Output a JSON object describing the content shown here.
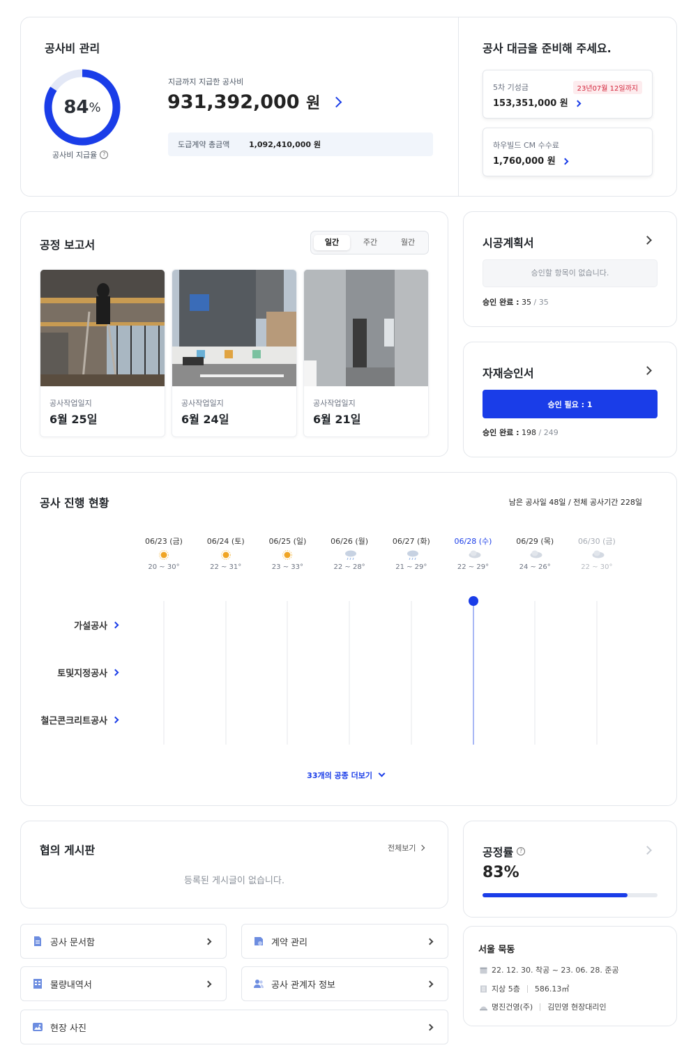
{
  "cost": {
    "title": "공사비 관리",
    "percent": "84",
    "percent_unit": "%",
    "percent_value": 0.84,
    "ring_label": "공사비 지급율",
    "paid_label": "지금까지 지급한 공사비",
    "paid_amount": "931,392,000",
    "won": "원",
    "contract_label": "도급계약 총금액",
    "contract_amount": "1,092,410,000 원"
  },
  "payment": {
    "title": "공사 대금을 준비해 주세요.",
    "items": [
      {
        "label": "5차 기성금",
        "amount": "153,351,000 원",
        "badge": "23년07월 12일까지"
      },
      {
        "label": "하우빌드 CM 수수료",
        "amount": "1,760,000 원",
        "badge": ""
      }
    ]
  },
  "report": {
    "title": "공정 보고서",
    "tabs": [
      "일간",
      "주간",
      "월간"
    ],
    "active_tab": "일간",
    "cards": [
      {
        "label": "공사작업일지",
        "date": "6월 25일"
      },
      {
        "label": "공사작업일지",
        "date": "6월 24일"
      },
      {
        "label": "공사작업일지",
        "date": "6월 21일"
      }
    ]
  },
  "plan": {
    "title": "시공계획서",
    "empty": "승인할 항목이 없습니다.",
    "done_label": "승인 완료 :",
    "done_count": "35",
    "done_total": "/ 35"
  },
  "material": {
    "title": "자재승인서",
    "button": "승인 필요 : 1",
    "done_label": "승인 완료 :",
    "done_count": "198",
    "done_total": "/ 249"
  },
  "progress": {
    "title": "공사 진행 현황",
    "summary": "남은 공사일 48일 / 전체 공사기간 228일",
    "days": [
      {
        "date": "06/23 (금)",
        "temp": "20 ~ 30°",
        "icon": "sun"
      },
      {
        "date": "06/24 (토)",
        "temp": "22 ~ 31°",
        "icon": "sun"
      },
      {
        "date": "06/25 (일)",
        "temp": "23 ~ 33°",
        "icon": "sun"
      },
      {
        "date": "06/26 (월)",
        "temp": "22 ~ 28°",
        "icon": "rain"
      },
      {
        "date": "06/27 (화)",
        "temp": "21 ~ 29°",
        "icon": "rain"
      },
      {
        "date": "06/28 (수)",
        "temp": "22 ~ 29°",
        "icon": "cloud"
      },
      {
        "date": "06/29 (목)",
        "temp": "24 ~ 26°",
        "icon": "cloud"
      },
      {
        "date": "06/30 (금)",
        "temp": "22 ~ 30°",
        "icon": "cloud"
      }
    ],
    "today_index": 5,
    "trades": [
      "가설공사",
      "토및지정공사",
      "철근콘크리트공사"
    ],
    "more": "33개의 공종 더보기"
  },
  "board": {
    "title": "협의 게시판",
    "view_all": "전체보기",
    "empty": "등록된 게시글이 없습니다."
  },
  "rate": {
    "title": "공정률",
    "value": "83%",
    "fraction": 0.83
  },
  "nav": [
    {
      "label": "공사 문서함",
      "icon": "document-icon"
    },
    {
      "label": "계약 관리",
      "icon": "contract-icon"
    },
    {
      "label": "물량내역서",
      "icon": "quantity-icon"
    },
    {
      "label": "공사 관계자 정보",
      "icon": "people-icon"
    },
    {
      "label": "현장 사진",
      "icon": "photo-icon"
    }
  ],
  "site": {
    "name": "서울 묵동",
    "period": "22. 12. 30. 착공 ~ 23. 06. 28. 준공",
    "floors": "지상 5층",
    "area": "586.13㎡",
    "company": "명진건영(주)",
    "manager": "김민영 현장대리인"
  },
  "colors": {
    "accent": "#1a3de8",
    "ring_track": "#e3e8f6",
    "danger": "#d3243a"
  }
}
